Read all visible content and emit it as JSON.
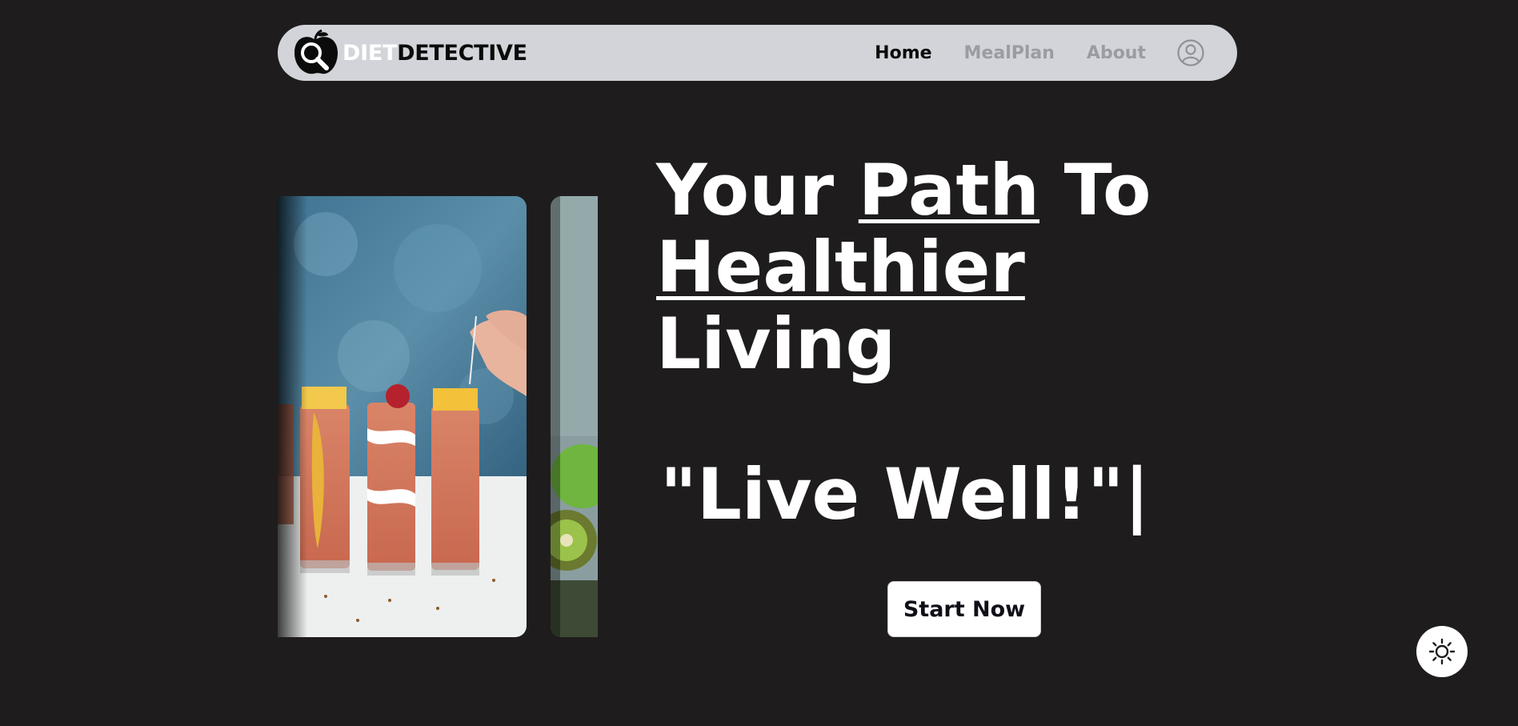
{
  "brand": {
    "part1": "DIET",
    "part2": "DETECTIVE",
    "logo_icon": "apple-magnifier-icon"
  },
  "nav": {
    "items": [
      {
        "label": "Home",
        "active": true
      },
      {
        "label": "MealPlan",
        "active": false
      },
      {
        "label": "About",
        "active": false
      }
    ],
    "profile_icon": "user-circle-icon"
  },
  "hero": {
    "title_word1": "Your",
    "title_word2": "Path",
    "title_word3": "To",
    "title_word4": "Healthier",
    "title_word5": "Living",
    "quote": "\"Live Well!\"|",
    "cta_label": "Start Now"
  },
  "carousel": {
    "slides": [
      {
        "description_icon": "smoothie-image"
      },
      {
        "description_icon": "kiwi-apple-image"
      }
    ]
  },
  "theme_toggle": {
    "icon": "sun-icon"
  },
  "colors": {
    "background": "#1e1c1d",
    "navbar": "#d2d4d9",
    "nav_inactive": "#9a9ca2",
    "text": "#ffffff"
  }
}
